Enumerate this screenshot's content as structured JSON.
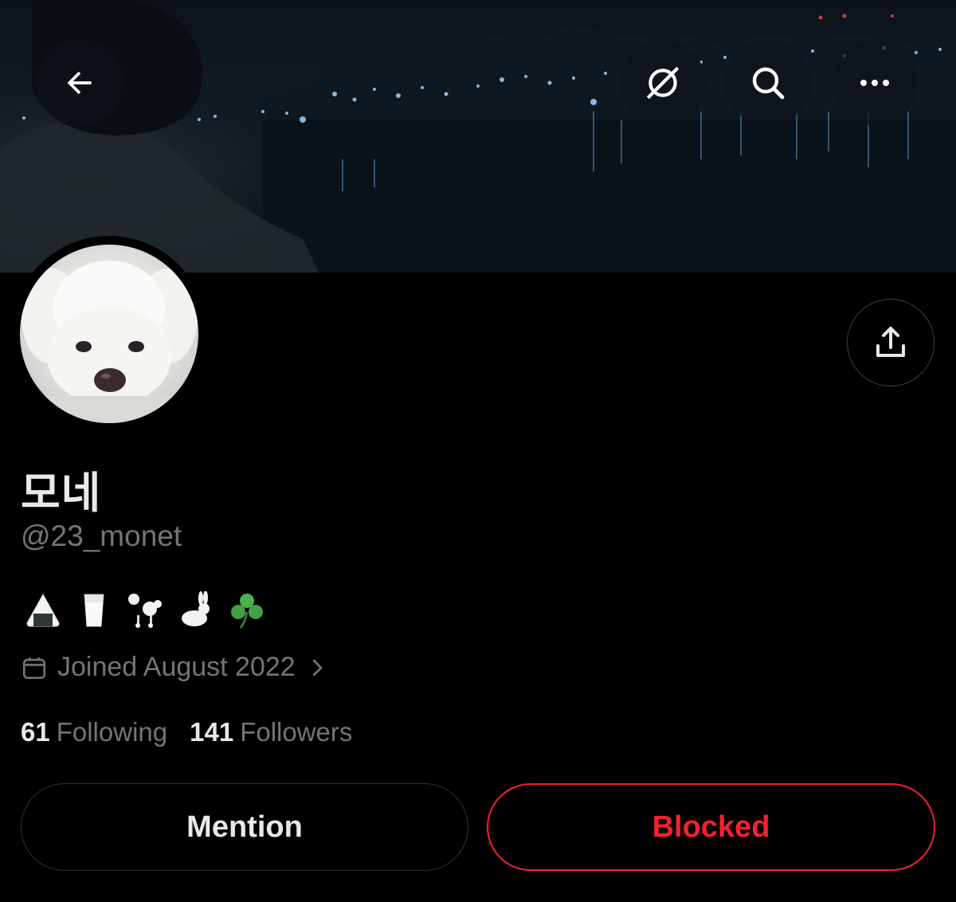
{
  "profile": {
    "display_name": "모네",
    "handle": "@23_monet",
    "bio_emojis": [
      "rice-ball",
      "milk-glass",
      "poodle",
      "rabbit",
      "shamrock"
    ],
    "joined": "Joined August 2022"
  },
  "stats": {
    "following_count": "61",
    "following_label": "Following",
    "followers_count": "141",
    "followers_label": "Followers"
  },
  "actions": {
    "mention_label": "Mention",
    "blocked_label": "Blocked"
  },
  "header_icons": [
    "back-arrow-icon",
    "grok-icon",
    "search-icon",
    "more-icon",
    "share-icon"
  ],
  "colors": {
    "background": "#000000",
    "text_primary": "#e7e9ea",
    "text_secondary": "#71767b",
    "blocked_red": "#f4212e",
    "border": "#2f3336"
  }
}
